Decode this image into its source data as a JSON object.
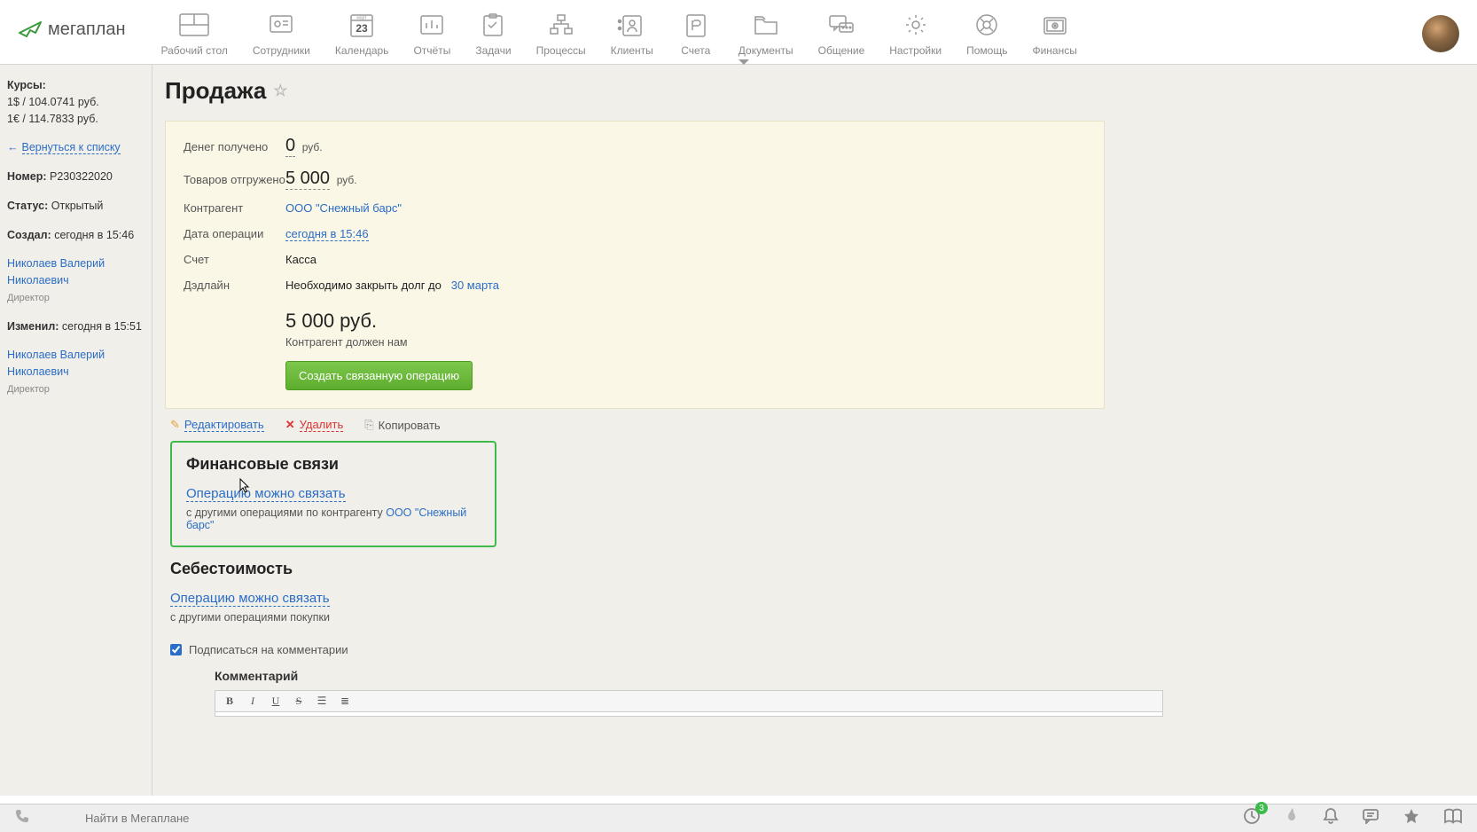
{
  "brand": "мегаплан",
  "nav": [
    {
      "id": "desktop",
      "label": "Рабочий стол"
    },
    {
      "id": "employees",
      "label": "Сотрудники"
    },
    {
      "id": "calendar",
      "label": "Календарь",
      "day": "23",
      "month": "март"
    },
    {
      "id": "reports",
      "label": "Отчёты"
    },
    {
      "id": "tasks",
      "label": "Задачи"
    },
    {
      "id": "processes",
      "label": "Процессы"
    },
    {
      "id": "clients",
      "label": "Клиенты"
    },
    {
      "id": "accounts",
      "label": "Счета"
    },
    {
      "id": "documents",
      "label": "Документы"
    },
    {
      "id": "chat",
      "label": "Общение"
    },
    {
      "id": "settings",
      "label": "Настройки"
    },
    {
      "id": "help",
      "label": "Помощь"
    },
    {
      "id": "finance",
      "label": "Финансы"
    }
  ],
  "sidebar": {
    "rates_title": "Курсы:",
    "rate_usd": "1$ / 104.0741 руб.",
    "rate_eur": "1€ / 114.7833 руб.",
    "back_arrow": "←",
    "back": "Вернуться к списку",
    "number_label": "Номер:",
    "number_value": "P230322020",
    "status_label": "Статус:",
    "status_value": "Открытый",
    "created_label": "Создал:",
    "created_value": "сегодня в 15:46",
    "creator_name": "Николаев Валерий Николаевич",
    "creator_role": "Директор",
    "changed_label": "Изменил:",
    "changed_value": "сегодня в 15:51",
    "changer_name": "Николаев Валерий Николаевич",
    "changer_role": "Директор"
  },
  "page": {
    "title": "Продажа",
    "fields": {
      "money_received_label": "Денег получено",
      "money_received_value": "0",
      "money_received_cur": "руб.",
      "shipped_label": "Товаров отгружено",
      "shipped_value": "5 000",
      "shipped_cur": "руб.",
      "counterparty_label": "Контрагент",
      "counterparty_value": "ООО \"Снежный барс\"",
      "op_date_label": "Дата операции",
      "op_date_value": "сегодня в 15:46",
      "account_label": "Счет",
      "account_value": "Касса",
      "deadline_label": "Дэдлайн",
      "deadline_prefix": "Необходимо закрыть долг до",
      "deadline_date": "30 марта"
    },
    "summary": {
      "amount": "5 000 руб.",
      "note": "Контрагент должен нам",
      "button": "Создать связанную операцию"
    },
    "actions": {
      "edit": "Редактировать",
      "delete": "Удалить",
      "copy": "Копировать"
    },
    "fin_links": {
      "title": "Финансовые связи",
      "link": "Операцию можно связать",
      "sub_prefix": "с другими операциями по контрагенту ",
      "sub_link": "ООО \"Снежный барс\""
    },
    "cost": {
      "title": "Себестоимость",
      "link": "Операцию можно связать",
      "sub": "с другими операциями покупки"
    },
    "subscribe": "Подписаться на комментарии",
    "comment_title": "Комментарий"
  },
  "footer": {
    "search_placeholder": "Найти в Мегаплане",
    "badge": "3"
  }
}
